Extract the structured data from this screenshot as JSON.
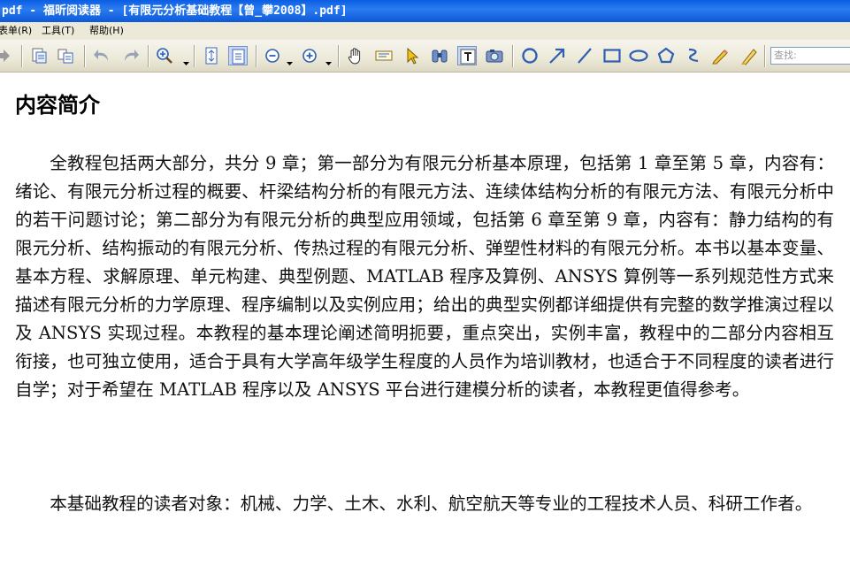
{
  "window": {
    "title": "pdf - 福昕阅读器 - [有限元分析基础教程【曾_攀2008】.pdf]"
  },
  "menu": {
    "items": [
      {
        "label": "表单(R)"
      },
      {
        "label": "工具(T)"
      },
      {
        "label": "帮助(H)"
      }
    ]
  },
  "toolbar": {
    "search_placeholder": "查找:",
    "icons": [
      "arrow-right-icon",
      "open-file-icon",
      "print-icon",
      "undo-icon",
      "redo-icon",
      "zoom-in-icon",
      "fit-page-icon",
      "fit-width-icon",
      "zoom-out-icon",
      "zoom-plus-icon",
      "hand-icon",
      "snapshot-icon",
      "select-arrow-icon",
      "binoculars-icon",
      "text-select-icon",
      "camera-icon",
      "circle-icon",
      "line-arrow-icon",
      "line-icon",
      "rectangle-icon",
      "ellipse-icon",
      "pentagon-icon",
      "squiggle-icon",
      "pencil-icon",
      "highlighter-icon"
    ]
  },
  "document": {
    "heading": "内容简介",
    "paragraphs": [
      "全教程包括两大部分，共分 9 章；第一部分为有限元分析基本原理，包括第 1 章至第 5 章，内容有：绪论、有限元分析过程的概要、杆梁结构分析的有限元方法、连续体结构分析的有限元方法、有限元分析中的若干问题讨论；第二部分为有限元分析的典型应用领域，包括第 6 章至第 9 章，内容有：静力结构的有限元分析、结构振动的有限元分析、传热过程的有限元分析、弹塑性材料的有限元分析。本书以基本变量、基本方程、求解原理、单元构建、典型例题、MATLAB 程序及算例、ANSYS 算例等一系列规范性方式来描述有限元分析的力学原理、程序编制以及实例应用；给出的典型实例都详细提供有完整的数学推演过程以及 ANSYS 实现过程。本教程的基本理论阐述简明扼要，重点突出，实例丰富，教程中的二部分内容相互衔接，也可独立使用，适合于具有大学高年级学生程度的人员作为培训教材，也适合于不同程度的读者进行自学；对于希望在 MATLAB 程序以及 ANSYS 平台进行建模分析的读者，本教程更值得参考。",
      "本基础教程的读者对象：机械、力学、土木、水利、航空航天等专业的工程技术人员、科研工作者。"
    ]
  },
  "colors": {
    "titlebar": "#0a5ee4",
    "toolbar_bg": "#ece9d8",
    "icon_blue": "#2f5fb3"
  }
}
